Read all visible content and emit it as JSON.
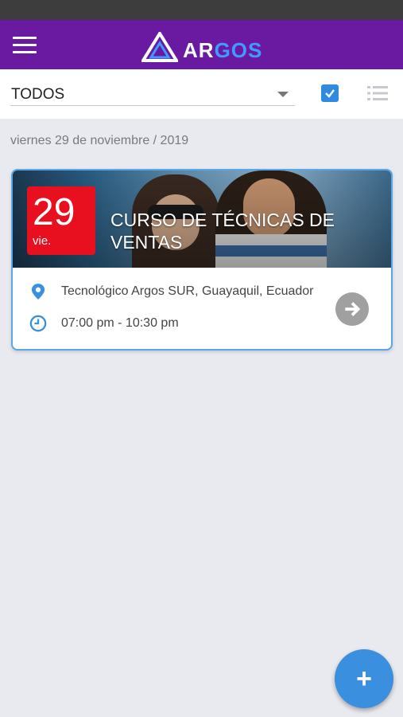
{
  "app": {
    "logo_part1": "AR",
    "logo_part2": "GOS",
    "brand_color": "#6a1aa0",
    "accent_color": "#3a8fde"
  },
  "filter": {
    "selected": "TODOS",
    "checkbox_checked": true
  },
  "date_heading": "viernes 29 de noviembre / 2019",
  "event": {
    "day": "29",
    "weekday": "vie.",
    "title": "CURSO DE TÉCNICAS DE VENTAS",
    "location": "Tecnológico Argos SUR, Guayaquil, Ecuador",
    "time": "07:00 pm - 10:30 pm",
    "badge_color": "#e8101e"
  },
  "fab": {
    "label": "+"
  },
  "icons": {
    "menu": "hamburger-menu-icon",
    "check": "checkbox-checked-icon",
    "list": "list-view-icon",
    "location": "location-pin-icon",
    "clock": "clock-icon",
    "arrow": "arrow-right-circle-icon",
    "add": "add-icon"
  }
}
